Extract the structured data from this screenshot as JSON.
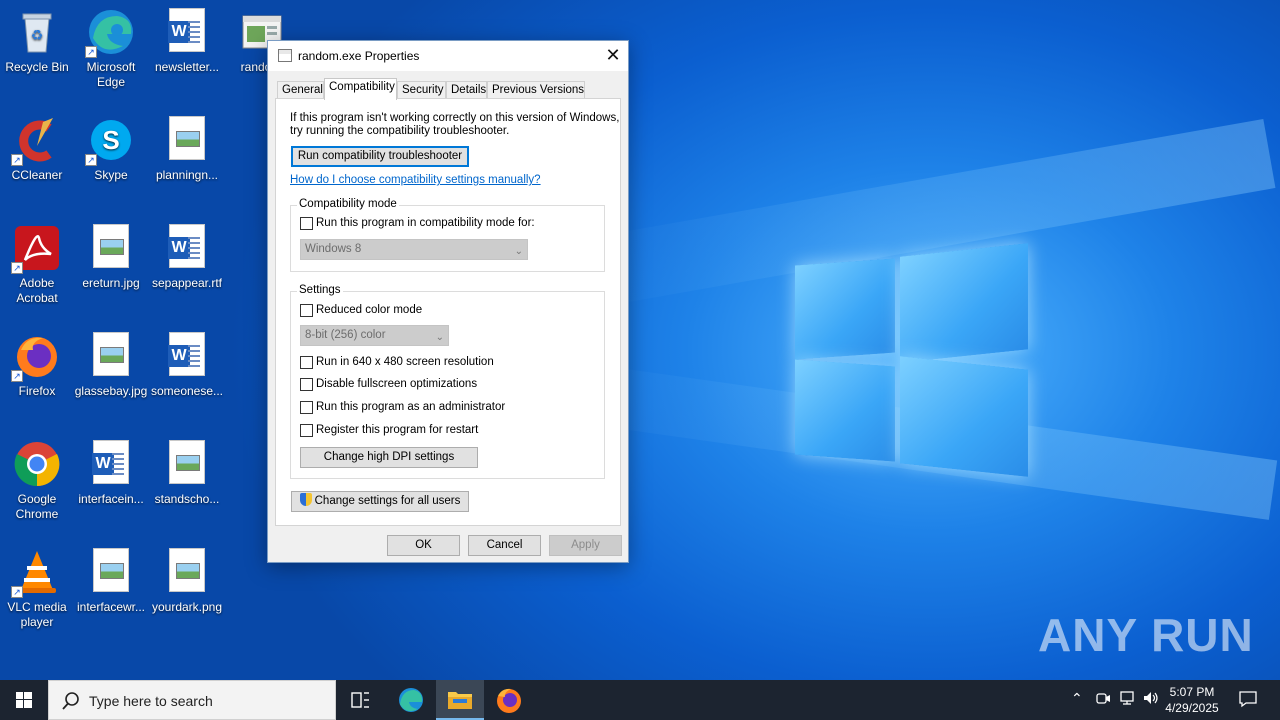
{
  "desktop": {
    "icons": [
      {
        "label": "Recycle Bin"
      },
      {
        "label": "Microsoft Edge"
      },
      {
        "label": "newsletter..."
      },
      {
        "label": "random"
      },
      {
        "label": "CCleaner"
      },
      {
        "label": "Skype"
      },
      {
        "label": "planningn..."
      },
      {
        "label": "Adobe Acrobat"
      },
      {
        "label": "ereturn.jpg"
      },
      {
        "label": "sepappear.rtf"
      },
      {
        "label": "Firefox"
      },
      {
        "label": "glassebay.jpg"
      },
      {
        "label": "someonese..."
      },
      {
        "label": "Google Chrome"
      },
      {
        "label": "interfacein..."
      },
      {
        "label": "standscho..."
      },
      {
        "label": "VLC media player"
      },
      {
        "label": "interfacewr..."
      },
      {
        "label": "yourdark.png"
      }
    ],
    "watermark": "ANY RUN"
  },
  "dialog": {
    "title": "random.exe Properties",
    "close_glyph": "✕",
    "tabs": [
      {
        "label": "General"
      },
      {
        "label": "Compatibility"
      },
      {
        "label": "Security"
      },
      {
        "label": "Details"
      },
      {
        "label": "Previous Versions"
      }
    ],
    "active_tab": "Compatibility",
    "intro_line1": "If this program isn't working correctly on this version of Windows,",
    "intro_line2": "try running the compatibility troubleshooter.",
    "troubleshooter_button": "Run compatibility troubleshooter",
    "manual_link": "How do I choose compatibility settings manually?",
    "compat_group": {
      "label": "Compatibility mode",
      "checkbox_label": "Run this program in compatibility mode for:",
      "checked": false,
      "select_value": "Windows 8"
    },
    "settings_group": {
      "label": "Settings",
      "reduced_color_label": "Reduced color mode",
      "color_select_value": "8-bit (256) color",
      "res_label": "Run in 640 x 480 screen resolution",
      "fullscreen_label": "Disable fullscreen optimizations",
      "admin_label": "Run this program as an administrator",
      "restart_label": "Register this program for restart",
      "dpi_button": "Change high DPI settings"
    },
    "all_users_button": "Change settings for all users",
    "ok_button": "OK",
    "cancel_button": "Cancel",
    "apply_button": "Apply"
  },
  "taskbar": {
    "search_placeholder": "Type here to search",
    "time": "5:07 PM",
    "date": "4/29/2025"
  },
  "colors": {
    "accent": "#0078d7",
    "taskbar": "#1c2430",
    "link": "#0066cc"
  }
}
